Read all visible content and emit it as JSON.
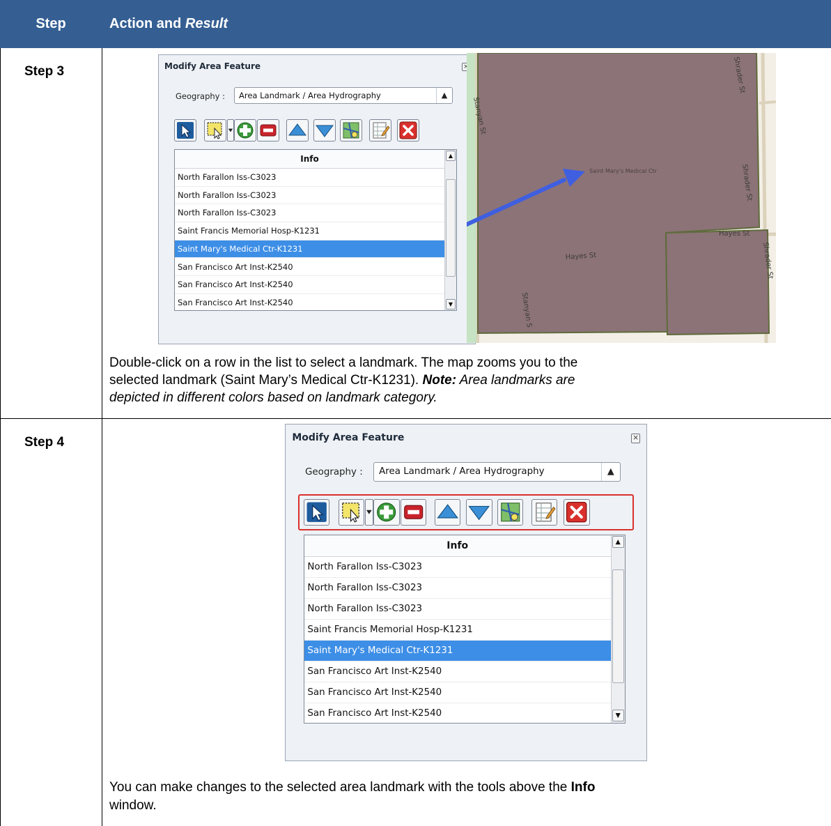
{
  "header": {
    "step_label": "Step",
    "action_label": "Action and ",
    "action_result_label": "Result",
    "bg_color": "#355f93"
  },
  "step3": {
    "label": "Step 3",
    "dialog": {
      "title": "Modify Area Feature",
      "geography_label": "Geography :",
      "geography_value": "Area Landmark / Area Hydrography",
      "list_header": "Info",
      "rows": [
        "North Farallon Iss-C3023",
        "North Farallon Iss-C3023",
        "North Farallon Iss-C3023",
        "Saint Francis Memorial Hosp-K1231",
        "Saint Mary's Medical Ctr-K1231",
        "San Francisco Art Inst-K2540",
        "San Francisco Art Inst-K2540",
        "San Francisco Art Inst-K2540"
      ],
      "selected_row_index": 4
    },
    "map": {
      "feature_label": "Saint Mary's Medical Ctr",
      "street_stanyan_top": "Stanyan St",
      "street_stanyan_bottom": "Stanyan S",
      "street_shrader_top": "Shrader St",
      "street_shrader_mid": "Shrader St",
      "street_shrader_low": "Shrader St",
      "street_hayes_1": "Hayes St",
      "street_hayes_2": "Hayes St",
      "fill_color": "#8c7377",
      "park_color": "#c6e3c4",
      "arrow_color": "#3f5fe0"
    },
    "paragraph_1": "Double-click on a row in the list to select a landmark. The map zooms you to the",
    "paragraph_2": "selected landmark (Saint Mary’s Medical Ctr-K1231). ",
    "note_bold": "Note:",
    "note_text": " Area landmarks are",
    "paragraph_3": "depicted in different colors based on landmark category."
  },
  "step4": {
    "label": "Step 4",
    "dialog": {
      "title": "Modify Area Feature",
      "geography_label": "Geography :",
      "geography_value": "Area Landmark / Area Hydrography",
      "list_header": "Info",
      "rows": [
        "North Farallon Iss-C3023",
        "North Farallon Iss-C3023",
        "North Farallon Iss-C3023",
        "Saint Francis Memorial Hosp-K1231",
        "Saint Mary's Medical Ctr-K1231",
        "San Francisco Art Inst-K2540",
        "San Francisco Art Inst-K2540",
        "San Francisco Art Inst-K2540"
      ],
      "selected_row_index": 4
    },
    "paragraph_1_a": "You can make changes to the selected area landmark with the tools above the ",
    "paragraph_1_bold": "Info",
    "paragraph_2": "window."
  },
  "toolbar_icons": [
    "select-pointer-icon",
    "select-box-icon",
    "add-icon",
    "remove-icon",
    "move-up-icon",
    "move-down-icon",
    "map-zoom-icon",
    "edit-table-icon",
    "delete-icon"
  ],
  "highlight_color": "#d9302c",
  "selection_color": "#3d8ee6"
}
